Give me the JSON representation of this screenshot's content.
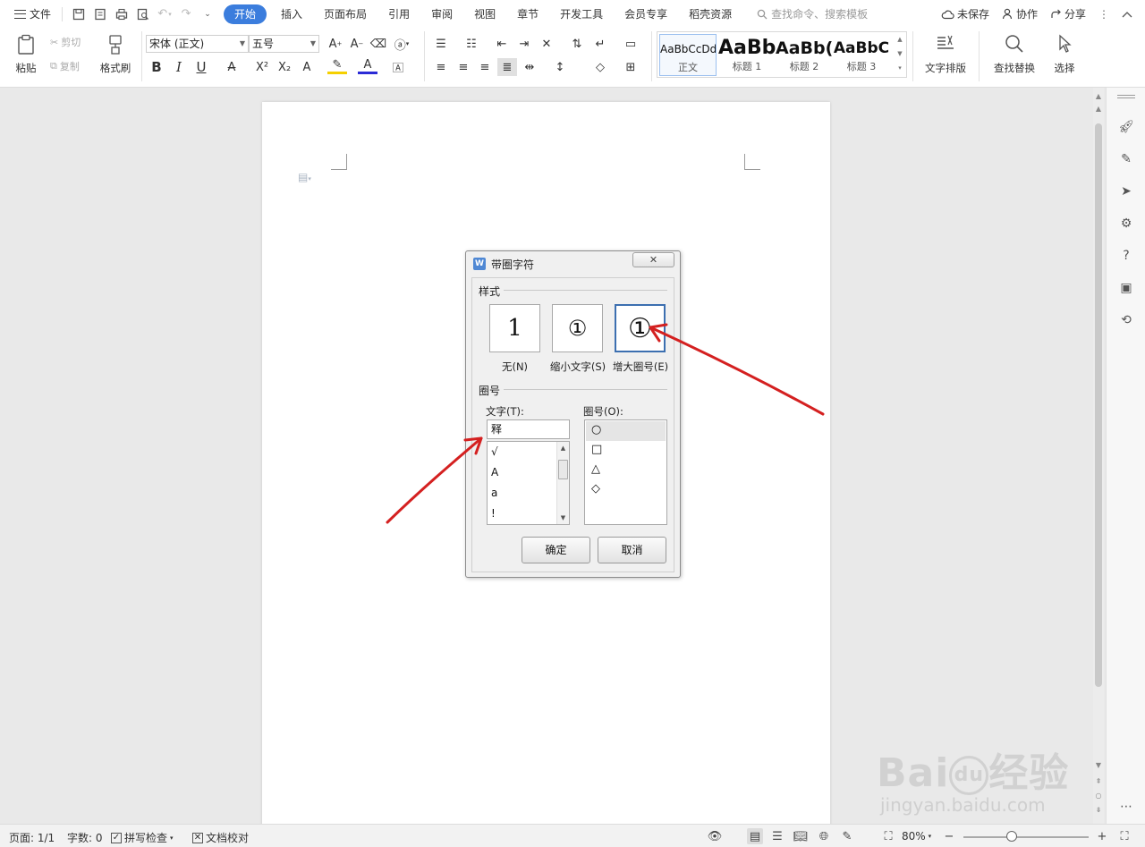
{
  "menubar": {
    "file_label": "文件",
    "tabs": [
      "开始",
      "插入",
      "页面布局",
      "引用",
      "审阅",
      "视图",
      "章节",
      "开发工具",
      "会员专享",
      "稻壳资源"
    ],
    "active_tab": "开始",
    "search_placeholder": "查找命令、搜索模板",
    "unsaved_label": "未保存",
    "collab_label": "协作",
    "share_label": "分享"
  },
  "ribbon": {
    "paste": "粘贴",
    "cut": "剪切",
    "copy": "复制",
    "format_painter": "格式刷",
    "font_name": "宋体 (正文)",
    "font_size": "五号",
    "bold": "B",
    "italic": "I",
    "underline": "U",
    "styles": [
      {
        "sample": "AaBbCcDd",
        "name": "正文"
      },
      {
        "sample": "AaBb",
        "name": "标题 1"
      },
      {
        "sample": "AaBb(",
        "name": "标题 2"
      },
      {
        "sample": "AaBbC",
        "name": "标题 3"
      }
    ],
    "text_layout": "文字排版",
    "find_replace": "查找替换",
    "select": "选择"
  },
  "dialog": {
    "title": "带圈字符",
    "close": "✕",
    "style_group": "样式",
    "styles": [
      {
        "glyph": "1",
        "caption": "无(N)"
      },
      {
        "glyph": "①",
        "caption": "缩小文字(S)"
      },
      {
        "glyph": "①",
        "caption": "增大圈号(E)"
      }
    ],
    "selected_style": "增大圈号(E)",
    "enclosure_group": "圈号",
    "text_label": "文字(T):",
    "text_value": "释",
    "text_list": [
      "√",
      "A",
      "a",
      "!"
    ],
    "enclosure_label": "圈号(O):",
    "enclosures": [
      "○",
      "□",
      "△",
      "◇"
    ],
    "selected_enclosure": "○",
    "ok": "确定",
    "cancel": "取消"
  },
  "statusbar": {
    "page": "页面: 1/1",
    "word_count": "字数: 0",
    "spell_check": "拼写检查",
    "proofread": "文档校对",
    "zoom": "80%"
  },
  "watermark": {
    "logo": "Bai du 经验",
    "url": "jingyan.baidu.com"
  },
  "colors": {
    "accent": "#3b7ddd",
    "annotation_arrow": "#d42020"
  }
}
